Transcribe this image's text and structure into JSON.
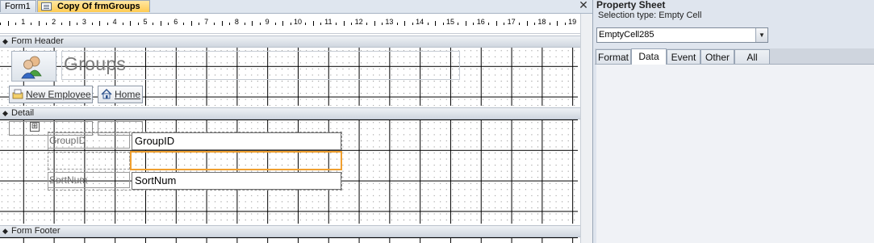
{
  "doc_tabs": [
    {
      "label": "Form1",
      "active": false
    },
    {
      "label": "Copy Of frmGroups",
      "active": true
    }
  ],
  "close_glyph": "✕",
  "ruler": {
    "numbers": [
      "1",
      "2",
      "3",
      "4",
      "5",
      "6",
      "7",
      "8",
      "9",
      "10",
      "11",
      "12",
      "13",
      "14",
      "15",
      "16",
      "17",
      "18",
      "19"
    ]
  },
  "sections": {
    "header": "Form Header",
    "detail": "Detail",
    "footer": "Form Footer"
  },
  "header": {
    "logo_icon": "users-group-icon",
    "title": "Groups",
    "buttons": [
      {
        "label": "New Employee",
        "icon": "new-record-icon"
      },
      {
        "label": "Home",
        "icon": "home-icon"
      }
    ]
  },
  "detail": {
    "fields": [
      {
        "label": "GroupID",
        "value": "GroupID"
      },
      {
        "label": "SortNum",
        "value": "SortNum"
      }
    ],
    "move_glyph": "⊞"
  },
  "property_sheet": {
    "title": "Property Sheet",
    "selection_type": "Selection type:  Empty Cell",
    "selected_object": "EmptyCell285",
    "tabs": [
      "Format",
      "Data",
      "Event",
      "Other",
      "All"
    ],
    "active_tab": "Data"
  },
  "colors": {
    "active_tab": "#ffcb52",
    "selection_outline": "#f0a030",
    "pane_bg": "#dfe5ee"
  }
}
